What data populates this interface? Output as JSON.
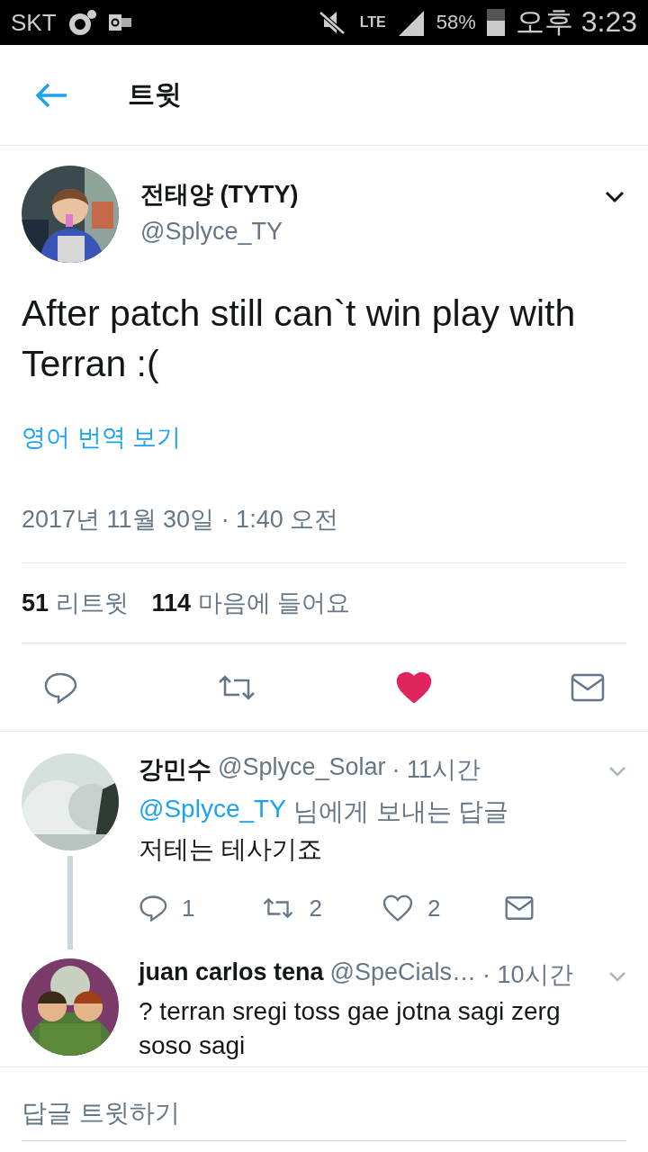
{
  "status_bar": {
    "carrier": "SKT",
    "network": "LTE",
    "battery": "58%",
    "time": "오후 3:23"
  },
  "header": {
    "title": "트윗"
  },
  "tweet": {
    "author": "전태양 (TYTY)",
    "handle": "@Splyce_TY",
    "text": "After patch still can`t win play with Terran :(",
    "translate": "영어 번역 보기",
    "date": "2017년 11월 30일 · 1:40 오전",
    "retweets": "51",
    "retweets_label": "리트윗",
    "likes": "114",
    "likes_label": "마음에 들어요",
    "liked": true
  },
  "replies": [
    {
      "author": "강민수",
      "handle": "@Splyce_Solar",
      "time": "· 11시간",
      "reply_to": "@Splyce_TY",
      "reply_to_suffix": "님에게 보내는 답글",
      "text": "저테는 테사기죠",
      "reply_count": "1",
      "retweet_count": "2",
      "like_count": "2",
      "liked": false,
      "thread_line": true
    },
    {
      "author": "juan carlos tena",
      "handle": "@SpeCials…",
      "time": "· 10시간",
      "text": "? terran sregi toss gae jotna sagi zerg soso sagi",
      "thread_line": false
    }
  ],
  "composer": {
    "placeholder": "답글 트윗하기"
  }
}
